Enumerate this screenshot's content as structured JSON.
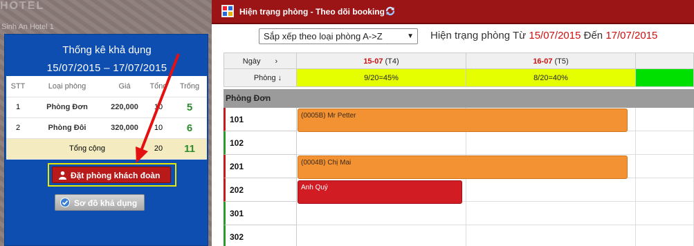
{
  "background": {
    "hotel_name": "HOTEL",
    "caption": "Sinh An Hotel 1"
  },
  "availability": {
    "title": "Thống kê khả dụng",
    "date_range": "15/07/2015 – 17/07/2015",
    "columns": [
      "STT",
      "Loại phòng",
      "Giá",
      "Tổng",
      "Trống"
    ],
    "rows": [
      {
        "stt": "1",
        "type": "Phòng Đơn",
        "price": "220,000",
        "total": "10",
        "free": "5"
      },
      {
        "stt": "2",
        "type": "Phòng Đôi",
        "price": "320,000",
        "total": "10",
        "free": "6"
      }
    ],
    "total_row": {
      "label": "Tổng cộng",
      "total": "20",
      "free": "11"
    },
    "group_booking_button": "Đặt phòng khách đoàn",
    "availability_map_button": "Sơ đồ khả dụng"
  },
  "header": {
    "title": "Hiện trạng phòng - Theo dõi booking"
  },
  "toolbar": {
    "sort_value": "Sắp xếp theo loại phòng A->Z",
    "status_prefix": "Hiện trạng phòng Từ",
    "from_date": "15/07/2015",
    "status_mid": "Đến",
    "to_date": "17/07/2015"
  },
  "grid": {
    "day_label": "Ngày",
    "room_label": "Phòng ↓",
    "day_arrow": "›",
    "days": [
      {
        "date": "15-07",
        "weekday": "(T4)",
        "occupancy": "9/20=45%"
      },
      {
        "date": "16-07",
        "weekday": "(T5)",
        "occupancy": "8/20=40%"
      }
    ],
    "room_group": "Phòng Đơn",
    "rooms": [
      "101",
      "102",
      "201",
      "202",
      "301",
      "302"
    ],
    "bookings": [
      {
        "room": "101",
        "label": "(0005B) Mr Petter"
      },
      {
        "room": "201",
        "label": "(0004B) Chị Mai"
      },
      {
        "room": "202",
        "label": "Anh Quý"
      }
    ]
  },
  "colors": {
    "header_red": "#9b1516",
    "panel_blue": "#0e4eb0",
    "occupancy_yellow": "#e6ff00",
    "occupancy_green": "#00e000",
    "booking_orange": "#f39232",
    "booking_red": "#d21c24"
  }
}
